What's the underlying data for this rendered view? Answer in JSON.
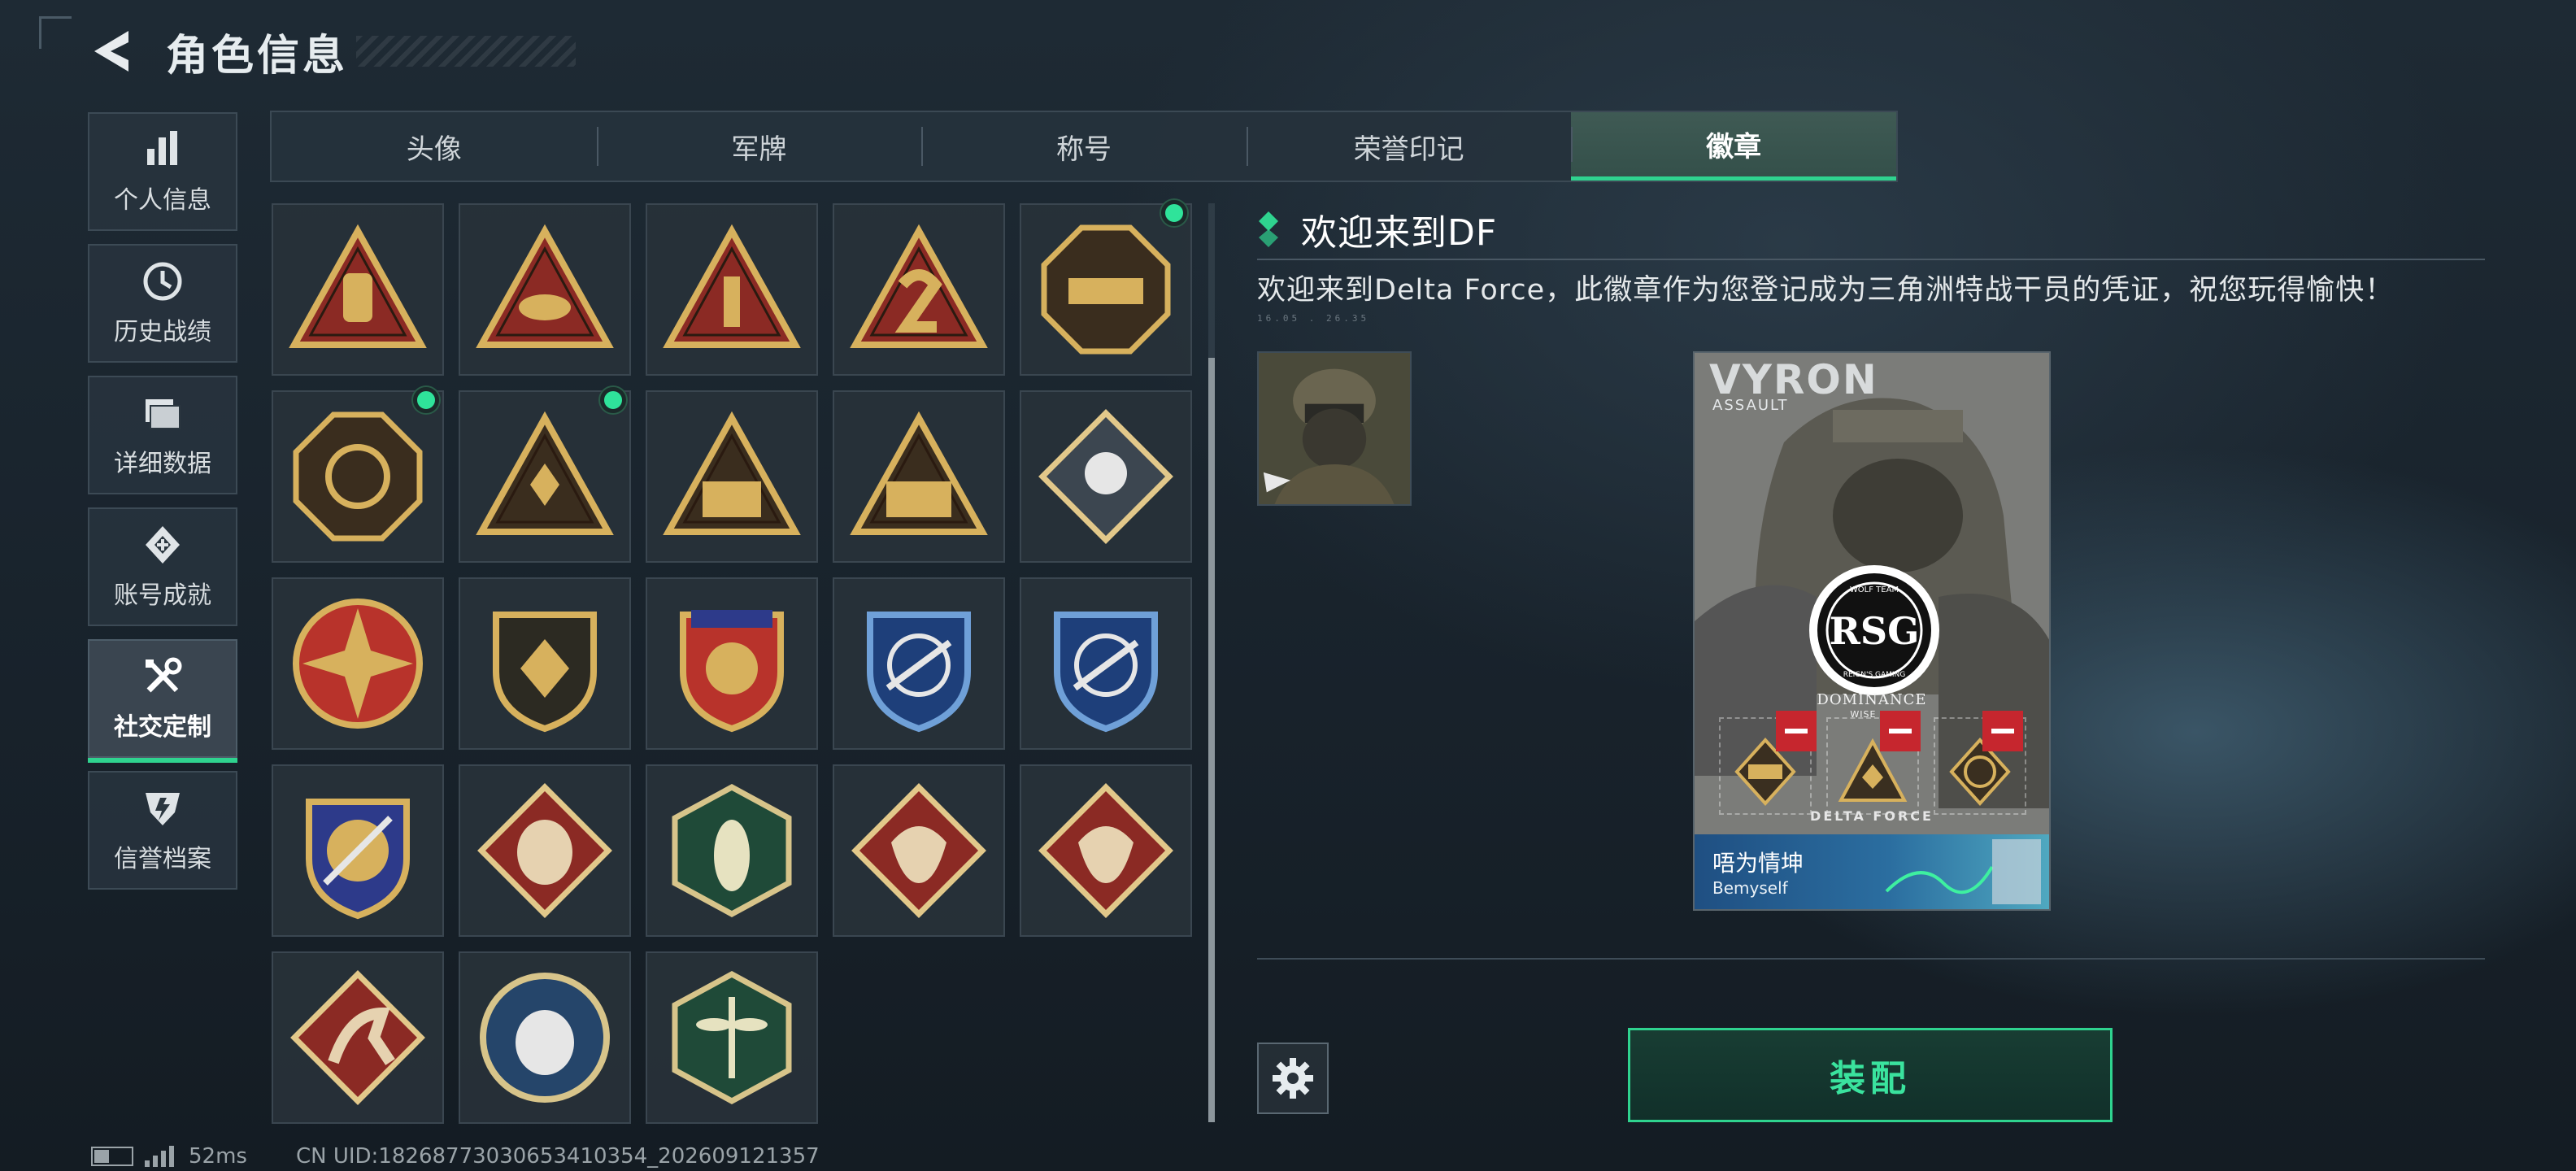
{
  "header": {
    "title": "角色信息"
  },
  "sidebar": {
    "items": [
      {
        "label": "个人信息",
        "icon": "bar-chart-icon",
        "active": false
      },
      {
        "label": "历史战绩",
        "icon": "history-clock-icon",
        "active": false
      },
      {
        "label": "详细数据",
        "icon": "folder-icon",
        "active": false
      },
      {
        "label": "账号成就",
        "icon": "achievement-icon",
        "active": false
      },
      {
        "label": "社交定制",
        "icon": "tools-icon",
        "active": true
      },
      {
        "label": "信誉档案",
        "icon": "credit-shield-icon",
        "active": false
      }
    ]
  },
  "tabs": [
    {
      "label": "头像",
      "active": false
    },
    {
      "label": "军牌",
      "active": false
    },
    {
      "label": "称号",
      "active": false
    },
    {
      "label": "荣誉印记",
      "active": false
    },
    {
      "label": "徽章",
      "active": true
    }
  ],
  "badges": [
    {
      "icon": "rock-hand-triangle-badge-icon",
      "new": false
    },
    {
      "icon": "lips-triangle-badge-icon",
      "new": false
    },
    {
      "icon": "number-1-triangle-badge-icon",
      "new": false
    },
    {
      "icon": "number-2-triangle-badge-icon",
      "new": false
    },
    {
      "icon": "delta-force-2026-tank-badge-icon",
      "new": true
    },
    {
      "icon": "delta-force-2026-globe-badge-icon",
      "new": true
    },
    {
      "icon": "diamond-hands-triangle-badge-icon",
      "new": true
    },
    {
      "icon": "soldiers-triangle-badge-icon",
      "new": false
    },
    {
      "icon": "soldiers-laurel-badge-icon",
      "new": false
    },
    {
      "icon": "rose-diamond-badge-icon",
      "new": false
    },
    {
      "icon": "skull-star-badge-icon",
      "new": false
    },
    {
      "icon": "chevron-shield-badge-icon",
      "new": false
    },
    {
      "icon": "stars-shield-badge-icon",
      "new": false
    },
    {
      "icon": "rifle-crosshair-blue-badge-icon",
      "new": false
    },
    {
      "icon": "rifle-crosshair-blue-badge-2-icon",
      "new": false
    },
    {
      "icon": "knife-crosshair-gold-badge-icon",
      "new": false
    },
    {
      "icon": "wolf-diamond-badge-icon",
      "new": false
    },
    {
      "icon": "wasp-hexagon-badge-icon",
      "new": false
    },
    {
      "icon": "dragon-diamond-badge-icon",
      "new": false
    },
    {
      "icon": "dragon-diamond-badge-2-icon",
      "new": false
    },
    {
      "icon": "runner-diamond-badge-icon",
      "new": false
    },
    {
      "icon": "lynx-circle-badge-icon",
      "new": false
    },
    {
      "icon": "dragonfly-hexagon-badge-icon",
      "new": false
    }
  ],
  "detail": {
    "title": "欢迎来到DF",
    "description": "欢迎来到Delta Force，此徽章作为您登记成为三角洲特战干员的凭证，祝您玩得愉快！",
    "code": "16.05 . 26.35"
  },
  "card": {
    "operator_name": "VYRON",
    "operator_role": "ASSAULT",
    "logo_top": "WOLF TEAM",
    "logo_text": "RSG",
    "logo_bottom": "REIGN'S GAMING",
    "dominance": "DOMINANCE",
    "wise_up": "WISE UP",
    "footer_mark": "DELTA FORCE",
    "banner_name": "唔为情坤",
    "banner_sub": "Bemyself"
  },
  "actions": {
    "equip_label": "装配"
  },
  "status": {
    "ping": "52ms",
    "uid": "CN UID:1826877303065341035­4_202609121357"
  },
  "colors": {
    "accent": "#2fd38f",
    "new_dot": "#2fe39a",
    "remove": "#c6262e",
    "badge_gold": "#d7b15d",
    "badge_red": "#8b2a24"
  }
}
